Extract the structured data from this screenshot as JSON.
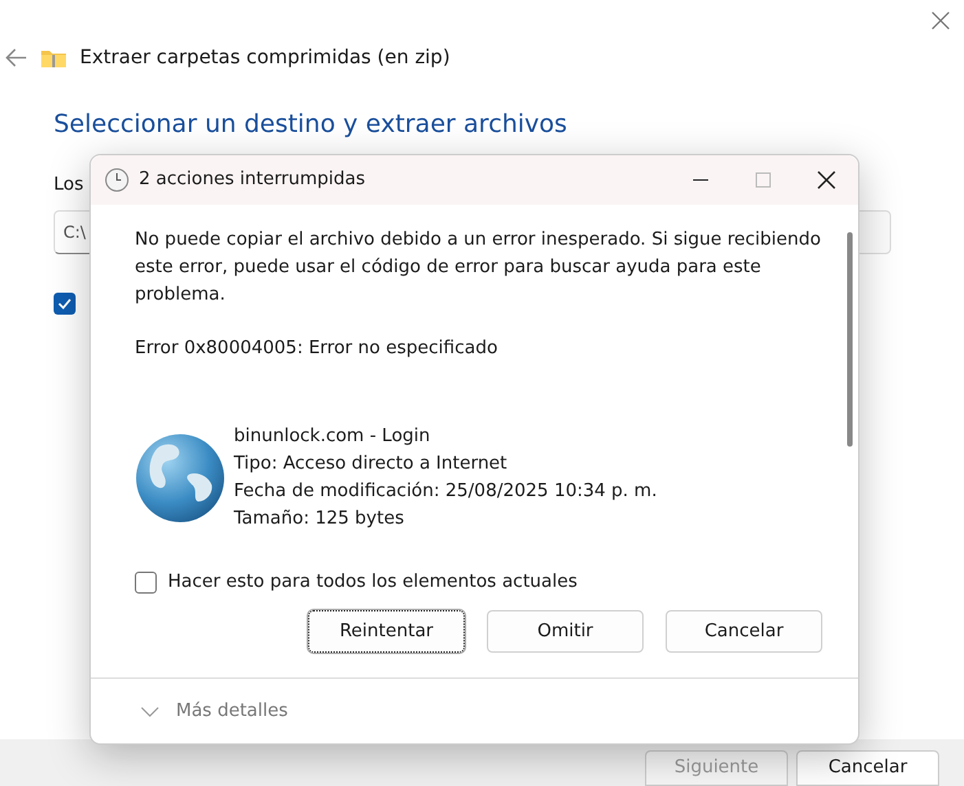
{
  "wizard": {
    "title": "Extraer carpetas comprimidas (en zip)",
    "heading": "Seleccionar un destino y extraer archivos",
    "field_label": "Los",
    "path_value": "C:\\",
    "checkbox": {
      "checked": true
    },
    "buttons": [
      {
        "label": "Siguiente",
        "disabled": true
      },
      {
        "label": "Cancelar",
        "disabled": false
      }
    ]
  },
  "dialog": {
    "title": "2 acciones interrumpidas",
    "message": "No puede copiar el archivo debido a un error inesperado. Si sigue recibiendo este error, puede usar el código de error para buscar ayuda para este problema.",
    "error": "Error 0x80004005: Error no especificado",
    "file": {
      "name": "binunlock.com - Login",
      "type": "Tipo: Acceso directo a Internet",
      "modified": "Fecha de modificación: 25/08/2025 10:34 p. m.",
      "size": "Tamaño: 125 bytes"
    },
    "apply_all": {
      "label": "Hacer esto para todos los elementos actuales",
      "checked": false
    },
    "buttons": [
      {
        "label": "Reintentar",
        "selected": true
      },
      {
        "label": "Omitir",
        "selected": false
      },
      {
        "label": "Cancelar",
        "selected": false
      }
    ],
    "details": {
      "label": "Más detalles",
      "expanded": false
    }
  }
}
